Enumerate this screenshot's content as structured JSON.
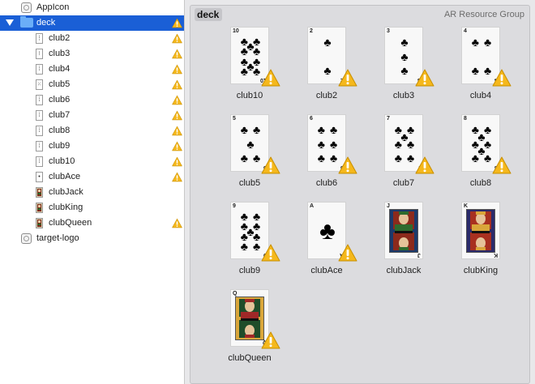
{
  "sidebar": {
    "items": [
      {
        "label": "AppIcon",
        "kind": "appicon",
        "level": 0,
        "warning": false,
        "selected": false
      },
      {
        "label": "deck",
        "kind": "folder",
        "level": 0,
        "warning": true,
        "selected": true,
        "expanded": true
      },
      {
        "label": "club2",
        "kind": "card",
        "glyph": "⋮",
        "level": 1,
        "warning": true
      },
      {
        "label": "club3",
        "kind": "card",
        "glyph": "⁝",
        "level": 1,
        "warning": true
      },
      {
        "label": "club4",
        "kind": "card",
        "glyph": "⁞",
        "level": 1,
        "warning": true
      },
      {
        "label": "club5",
        "kind": "card",
        "glyph": "⁙",
        "level": 1,
        "warning": true
      },
      {
        "label": "club6",
        "kind": "card",
        "glyph": "⁞",
        "level": 1,
        "warning": true
      },
      {
        "label": "club7",
        "kind": "card",
        "glyph": "⁞",
        "level": 1,
        "warning": true
      },
      {
        "label": "club8",
        "kind": "card",
        "glyph": "⁞",
        "level": 1,
        "warning": true
      },
      {
        "label": "club9",
        "kind": "card",
        "glyph": "⁞",
        "level": 1,
        "warning": true
      },
      {
        "label": "club10",
        "kind": "card",
        "glyph": "⁞",
        "level": 1,
        "warning": true
      },
      {
        "label": "clubAce",
        "kind": "card",
        "glyph": "•",
        "level": 1,
        "warning": true
      },
      {
        "label": "clubJack",
        "kind": "face",
        "glyph": "",
        "level": 1,
        "warning": false
      },
      {
        "label": "clubKing",
        "kind": "face",
        "glyph": "",
        "level": 1,
        "warning": false
      },
      {
        "label": "clubQueen",
        "kind": "face",
        "glyph": "",
        "level": 1,
        "warning": true
      },
      {
        "label": "target-logo",
        "kind": "appicon",
        "level": 0,
        "warning": false,
        "selected": false
      }
    ]
  },
  "group": {
    "name": "deck",
    "type": "AR Resource Group"
  },
  "tiles": [
    {
      "label": "club10",
      "rank": "10",
      "pips": 10,
      "warning": true
    },
    {
      "label": "club2",
      "rank": "2",
      "pips": 2,
      "warning": true
    },
    {
      "label": "club3",
      "rank": "3",
      "pips": 3,
      "warning": true
    },
    {
      "label": "club4",
      "rank": "4",
      "pips": 4,
      "warning": true
    },
    {
      "label": "club5",
      "rank": "5",
      "pips": 5,
      "warning": true
    },
    {
      "label": "club6",
      "rank": "6",
      "pips": 6,
      "warning": true
    },
    {
      "label": "club7",
      "rank": "7",
      "pips": 7,
      "warning": true
    },
    {
      "label": "club8",
      "rank": "8",
      "pips": 8,
      "warning": true
    },
    {
      "label": "club9",
      "rank": "9",
      "pips": 9,
      "warning": true
    },
    {
      "label": "clubAce",
      "rank": "A",
      "pips": 1,
      "warning": true
    },
    {
      "label": "clubJack",
      "rank": "J",
      "pips": 0,
      "face": true,
      "warning": false
    },
    {
      "label": "clubKing",
      "rank": "K",
      "pips": 0,
      "face": true,
      "warning": false
    },
    {
      "label": "clubQueen",
      "rank": "Q",
      "pips": 0,
      "face": true,
      "warning": true
    }
  ],
  "colors": {
    "selection": "#1a5fd6",
    "warning": "#f5b81c",
    "folder": "#6aaef8"
  }
}
